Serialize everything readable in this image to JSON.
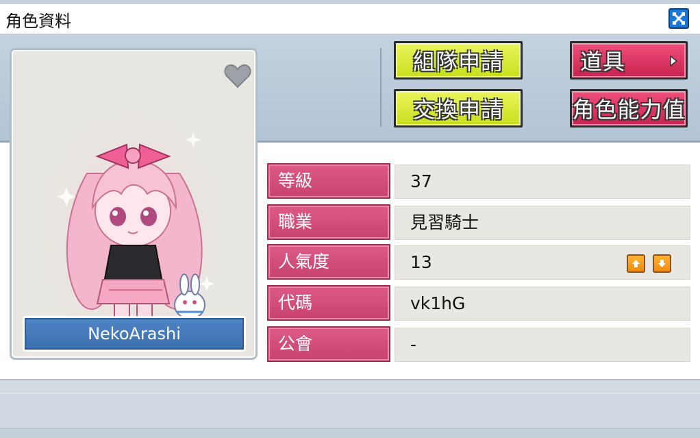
{
  "window": {
    "title": "角色資料",
    "close_icon": "close-icon"
  },
  "character": {
    "name": "NekoArashi",
    "favorite_icon": "heart-icon"
  },
  "buttons": {
    "party_request": "組隊申請",
    "trade_request": "交換申請",
    "items": "道具",
    "stats": "角色能力值"
  },
  "info": {
    "level": {
      "label": "等級",
      "value": "37"
    },
    "job": {
      "label": "職業",
      "value": "見習騎士"
    },
    "fame": {
      "label": "人氣度",
      "value": "13"
    },
    "code": {
      "label": "代碼",
      "value": "vk1hG"
    },
    "guild": {
      "label": "公會",
      "value": "-"
    }
  },
  "colors": {
    "label_pink": "#c8426f",
    "button_green": "#c7df1d",
    "button_red": "#c8234f",
    "name_blue": "#3d6fae",
    "fame_orange": "#f08a0d"
  }
}
